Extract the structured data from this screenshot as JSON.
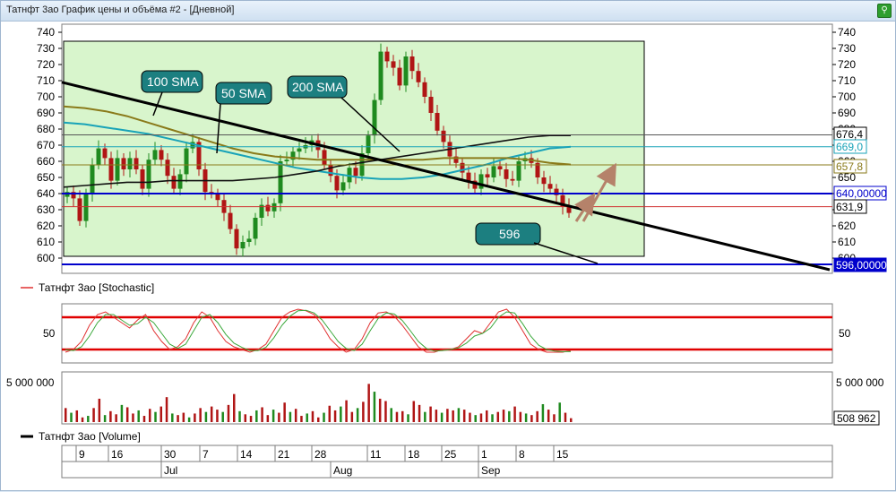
{
  "window": {
    "title": "Татнфт 3ао График цены и объёма #2 - [Дневной]"
  },
  "price_panel": {
    "price_labels": [
      {
        "text": "676,4",
        "color": "#000000"
      },
      {
        "text": "669,0",
        "color": "#19a3b8"
      },
      {
        "text": "657,8",
        "color": "#8a7a1a"
      },
      {
        "text": "640,00000",
        "color": "#0000cc"
      },
      {
        "text": "631,9",
        "color": "#000000"
      },
      {
        "text": "596,00000",
        "color": "#0000cc"
      }
    ],
    "annotations": [
      "100 SMA",
      "50 SMA",
      "200 SMA",
      "596"
    ]
  },
  "stochastic_panel": {
    "legend": "Татнфт 3ао [Stochastic]",
    "tick_label": "50"
  },
  "volume_panel": {
    "tick_label": "5 000 000",
    "last_value": "508 962",
    "legend": "Татнфт 3ао [Volume]"
  },
  "date_axis": {
    "days": [
      "9",
      "16",
      "30",
      "7",
      "14",
      "21",
      "28",
      "11",
      "18",
      "25",
      "1",
      "8",
      "15"
    ],
    "months": [
      "Jul",
      "Aug",
      "Sep"
    ]
  },
  "colors": {
    "up": "#1f8a1f",
    "down": "#b01515",
    "highlight_bg": "#d8f5cc",
    "sma50": "#19a3b8",
    "sma100": "#8a7a1a",
    "sma200": "#111111",
    "level": "#0000cc",
    "annotation": "#1c7f80",
    "arrow": "#b5826a"
  },
  "chart_data": [
    {
      "type": "candlestick",
      "ylim": [
        596,
        740
      ],
      "yticks": [
        600,
        610,
        620,
        630,
        640,
        650,
        660,
        670,
        680,
        690,
        700,
        710,
        720,
        730,
        740
      ],
      "x_day_labels": [
        "9",
        "16",
        "30",
        "7",
        "14",
        "21",
        "28",
        "11",
        "18",
        "25",
        "1",
        "8",
        "15"
      ],
      "months": [
        "Jul",
        "Aug",
        "Sep"
      ],
      "close": [
        641,
        637,
        623,
        640,
        658,
        668,
        662,
        648,
        662,
        655,
        662,
        655,
        643,
        661,
        667,
        661,
        651,
        643,
        652,
        668,
        672,
        655,
        641,
        640,
        636,
        628,
        618,
        606,
        610,
        612,
        625,
        633,
        629,
        634,
        660,
        661,
        666,
        668,
        670,
        673,
        667,
        658,
        651,
        642,
        647,
        656,
        651,
        665,
        676,
        698,
        728,
        722,
        718,
        707,
        725,
        716,
        709,
        700,
        690,
        679,
        672,
        663,
        659,
        653,
        648,
        643,
        652,
        650,
        657,
        655,
        649,
        648,
        660,
        662,
        659,
        650,
        646,
        643,
        639,
        632,
        628
      ],
      "series": [
        {
          "name": "",
          "values": [
            684,
            683,
            681,
            679,
            677,
            674,
            671,
            668,
            665,
            662,
            659,
            656,
            654,
            652,
            650,
            649,
            649,
            650,
            652,
            655,
            658,
            662,
            665,
            668,
            669
          ]
        },
        {
          "name": "",
          "values": [
            694,
            693,
            691,
            688,
            684,
            680,
            676,
            672,
            668,
            665,
            663,
            662,
            661,
            661,
            661,
            661,
            661,
            661,
            662,
            662,
            662,
            662,
            661,
            659,
            658
          ]
        },
        {
          "name": "",
          "values": [
            644,
            645,
            646,
            647,
            647,
            648,
            648,
            648,
            648,
            649,
            650,
            652,
            654,
            657,
            659,
            661,
            663,
            665,
            667,
            669,
            671,
            673,
            675,
            676,
            676
          ]
        }
      ],
      "levels": [
        640,
        631.9,
        596
      ],
      "trendline": {
        "from": 709,
        "to": 596
      }
    },
    {
      "type": "line",
      "title": "Татнфт 3ао [Stochastic]",
      "ylim": [
        0,
        100
      ],
      "levels": [
        80,
        20
      ],
      "series": [
        {
          "name": "",
          "values": [
            15,
            20,
            35,
            65,
            85,
            90,
            80,
            70,
            60,
            75,
            85,
            55,
            35,
            20,
            25,
            40,
            70,
            90,
            80,
            55,
            35,
            25,
            20,
            15,
            20,
            30,
            55,
            80,
            90,
            95,
            92,
            85,
            65,
            40,
            25,
            15,
            20,
            40,
            70,
            88,
            90,
            82,
            65,
            45,
            25,
            15,
            15,
            20,
            20,
            25,
            40,
            55,
            50,
            70,
            90,
            95,
            80,
            55,
            30,
            20,
            15,
            15,
            15,
            18
          ]
        },
        {
          "name": "",
          "values": [
            20,
            18,
            25,
            45,
            70,
            85,
            85,
            75,
            65,
            68,
            80,
            70,
            50,
            30,
            22,
            30,
            55,
            80,
            85,
            70,
            48,
            32,
            24,
            18,
            18,
            24,
            42,
            65,
            82,
            92,
            93,
            88,
            75,
            55,
            35,
            22,
            18,
            30,
            55,
            78,
            88,
            86,
            74,
            55,
            35,
            22,
            17,
            18,
            20,
            23,
            32,
            45,
            50,
            60,
            80,
            90,
            88,
            68,
            45,
            28,
            20,
            17,
            16,
            16
          ]
        }
      ]
    },
    {
      "type": "bar",
      "title": "Татнфт 3ао [Volume]",
      "ylim": [
        0,
        5500000
      ],
      "ytick_label": "5 000 000",
      "last_value": 508962,
      "values": [
        1.8,
        1.2,
        1.5,
        0.6,
        0.8,
        1.8,
        3.0,
        0.9,
        1.4,
        1.0,
        2.2,
        1.9,
        1.1,
        1.5,
        0.8,
        1.7,
        1.3,
        2.0,
        3.2,
        1.1,
        0.9,
        1.2,
        0.6,
        1.1,
        1.8,
        1.3,
        2.0,
        1.6,
        1.3,
        2.2,
        3.6,
        1.4,
        1.0,
        0.8,
        1.5,
        1.9,
        0.9,
        1.6,
        1.2,
        2.5,
        1.3,
        1.7,
        0.8,
        1.1,
        1.4,
        0.6,
        1.2,
        2.1,
        1.5,
        2.0,
        2.8,
        1.3,
        1.8,
        2.6,
        4.9,
        3.9,
        3.0,
        2.7,
        1.8,
        1.3,
        1.4,
        1.0,
        2.7,
        2.2,
        1.3,
        2.0,
        1.6,
        1.2,
        1.7,
        1.5,
        1.8,
        1.6,
        1.2,
        0.9,
        1.1,
        1.5,
        1.0,
        1.3,
        1.6,
        1.4,
        2.0,
        1.3,
        1.1,
        0.9,
        1.4,
        2.3,
        1.6,
        1.0,
        2.5,
        1.2,
        0.5
      ]
    }
  ]
}
